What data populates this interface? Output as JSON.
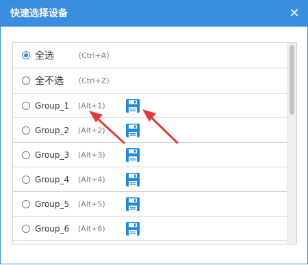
{
  "dialog": {
    "title": "快速选择设备",
    "close_symbol": "✕"
  },
  "items": [
    {
      "label": "全选",
      "shortcut": "（Ctrl+A）",
      "checked": true,
      "has_save": false
    },
    {
      "label": "全不选",
      "shortcut": "（Ctrl+Z）",
      "checked": false,
      "has_save": false
    },
    {
      "label": "Group_1",
      "shortcut": "(Alt+1)",
      "checked": false,
      "has_save": true
    },
    {
      "label": "Group_2",
      "shortcut": "(Alt+2)",
      "checked": false,
      "has_save": true
    },
    {
      "label": "Group_3",
      "shortcut": "(Alt+3)",
      "checked": false,
      "has_save": true
    },
    {
      "label": "Group_4",
      "shortcut": "(Alt+4)",
      "checked": false,
      "has_save": true
    },
    {
      "label": "Group_5",
      "shortcut": "(Alt+5)",
      "checked": false,
      "has_save": true
    },
    {
      "label": "Group_6",
      "shortcut": "(Alt+6)",
      "checked": false,
      "has_save": true
    }
  ],
  "icons": {
    "close": "close-icon",
    "radio": "radio-icon",
    "save": "save-floppy-icon",
    "arrow": "red-arrow-annotation"
  },
  "colors": {
    "accent": "#3a8ee0",
    "radio_checked": "#2d8be0",
    "save_icon": "#1e88e5",
    "annotation_arrow": "#e53935"
  }
}
